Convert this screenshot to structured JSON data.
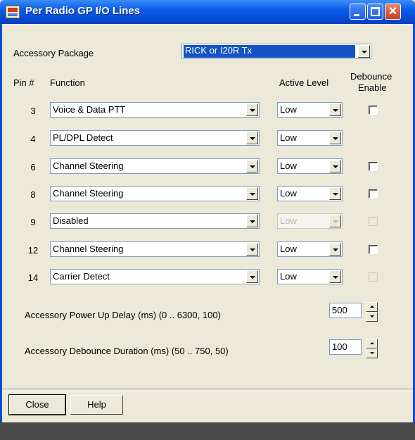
{
  "window": {
    "title": "Per Radio GP I/O Lines"
  },
  "accessory": {
    "label": "Accessory Package",
    "selected": "RICK or I20R Tx"
  },
  "headers": {
    "pin": "Pin #",
    "function": "Function",
    "active_level": "Active Level",
    "debounce_line1": "Debounce",
    "debounce_line2": "Enable"
  },
  "rows": [
    {
      "pin": "3",
      "function": "Voice & Data PTT",
      "level": "Low",
      "level_disabled": false,
      "debounce": "unchecked"
    },
    {
      "pin": "4",
      "function": "PL/DPL Detect",
      "level": "Low",
      "level_disabled": false,
      "debounce": "none"
    },
    {
      "pin": "6",
      "function": "Channel Steering",
      "level": "Low",
      "level_disabled": false,
      "debounce": "unchecked"
    },
    {
      "pin": "8",
      "function": "Channel Steering",
      "level": "Low",
      "level_disabled": false,
      "debounce": "unchecked"
    },
    {
      "pin": "9",
      "function": "Disabled",
      "level": "Low",
      "level_disabled": true,
      "debounce": "disabled"
    },
    {
      "pin": "12",
      "function": "Channel Steering",
      "level": "Low",
      "level_disabled": false,
      "debounce": "unchecked"
    },
    {
      "pin": "14",
      "function": "Carrier Detect",
      "level": "Low",
      "level_disabled": false,
      "debounce": "disabled"
    }
  ],
  "power_up_delay": {
    "label": "Accessory Power Up Delay (ms) (0 .. 6300, 100)",
    "value": "500"
  },
  "debounce_duration": {
    "label": "Accessory Debounce Duration (ms) (50 .. 750, 50)",
    "value": "100"
  },
  "buttons": {
    "close": "Close",
    "help": "Help"
  },
  "icons": {
    "app": "radio-app-icon",
    "minimize": "minimize-icon",
    "maximize": "maximize-icon",
    "close": "close-icon",
    "dropdown": "chevron-down-icon"
  },
  "colors": {
    "titlebar": "#0a5ee8",
    "dialog_bg": "#ece9d8",
    "selection": "#1553c5"
  }
}
